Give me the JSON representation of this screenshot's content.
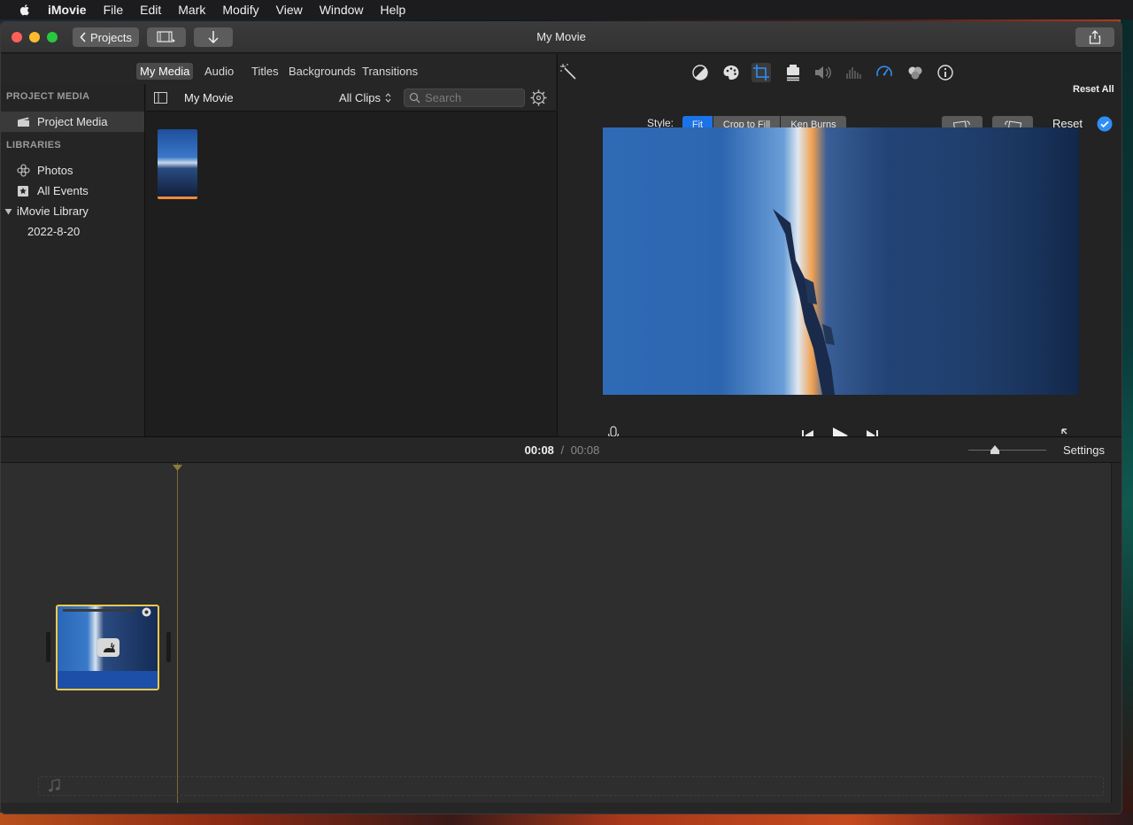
{
  "menubar": {
    "app_name": "iMovie",
    "items": [
      "File",
      "Edit",
      "Mark",
      "Modify",
      "View",
      "Window",
      "Help"
    ]
  },
  "window": {
    "title": "My Movie",
    "projects_button": "Projects"
  },
  "browser": {
    "tabs": [
      "My Media",
      "Audio",
      "Titles",
      "Backgrounds",
      "Transitions"
    ],
    "active_tab": "My Media"
  },
  "sidebar": {
    "project_media_header": "PROJECT MEDIA",
    "project_media_item": "Project Media",
    "libraries_header": "LIBRARIES",
    "photos": "Photos",
    "all_events": "All Events",
    "library": "iMovie Library",
    "event": "2022-8-20"
  },
  "media": {
    "title": "My Movie",
    "filter": "All Clips",
    "search_placeholder": "Search"
  },
  "viewer": {
    "reset_all": "Reset All",
    "style_label": "Style:",
    "styles": [
      "Fit",
      "Crop to Fill",
      "Ken Burns"
    ],
    "selected_style": "Fit",
    "reset": "Reset",
    "accent_color": "#1a73e8"
  },
  "timeline": {
    "current_time": "00:08",
    "separator": "/",
    "total_time": "00:08",
    "settings": "Settings"
  }
}
